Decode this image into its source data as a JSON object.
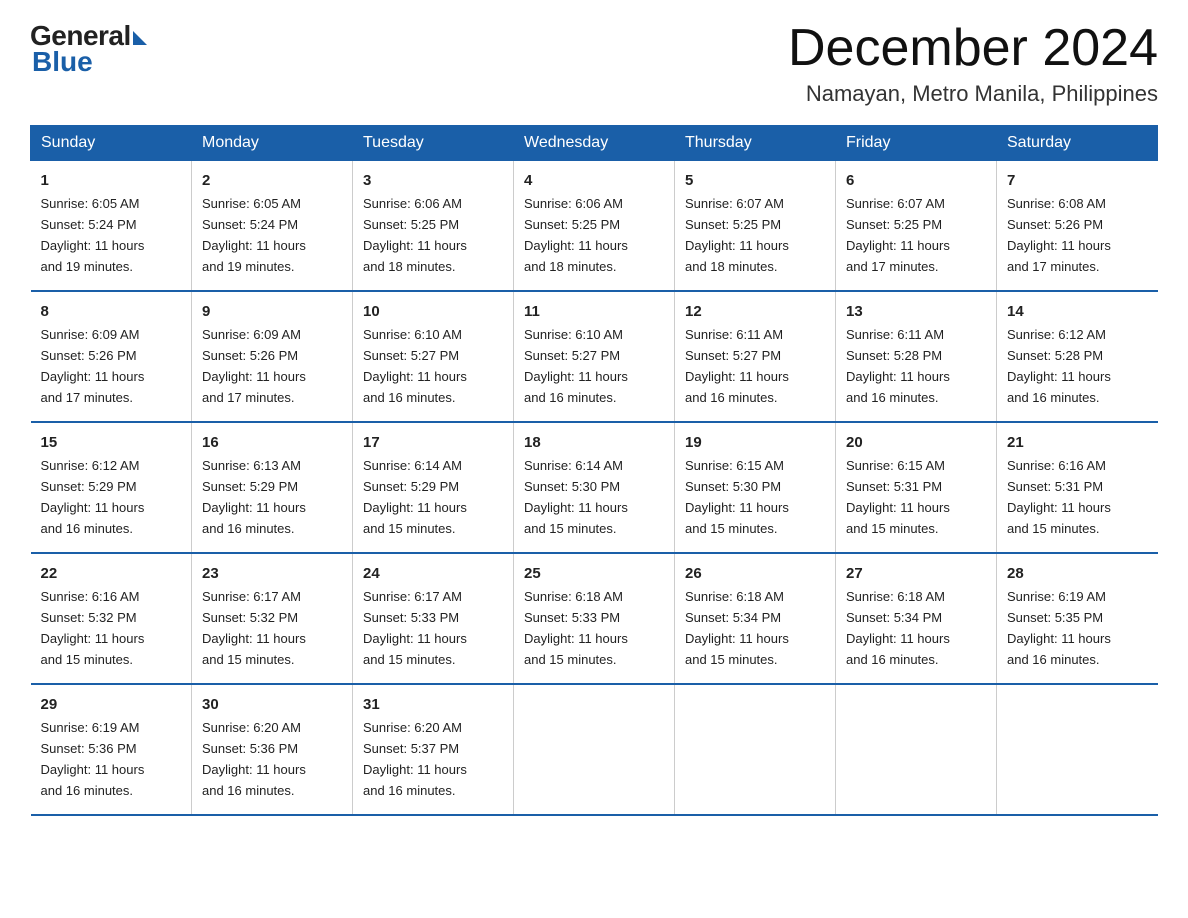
{
  "logo": {
    "general": "General",
    "blue": "Blue"
  },
  "title": "December 2024",
  "location": "Namayan, Metro Manila, Philippines",
  "days_of_week": [
    "Sunday",
    "Monday",
    "Tuesday",
    "Wednesday",
    "Thursday",
    "Friday",
    "Saturday"
  ],
  "weeks": [
    [
      {
        "day": "1",
        "sunrise": "6:05 AM",
        "sunset": "5:24 PM",
        "daylight": "11 hours and 19 minutes."
      },
      {
        "day": "2",
        "sunrise": "6:05 AM",
        "sunset": "5:24 PM",
        "daylight": "11 hours and 19 minutes."
      },
      {
        "day": "3",
        "sunrise": "6:06 AM",
        "sunset": "5:25 PM",
        "daylight": "11 hours and 18 minutes."
      },
      {
        "day": "4",
        "sunrise": "6:06 AM",
        "sunset": "5:25 PM",
        "daylight": "11 hours and 18 minutes."
      },
      {
        "day": "5",
        "sunrise": "6:07 AM",
        "sunset": "5:25 PM",
        "daylight": "11 hours and 18 minutes."
      },
      {
        "day": "6",
        "sunrise": "6:07 AM",
        "sunset": "5:25 PM",
        "daylight": "11 hours and 17 minutes."
      },
      {
        "day": "7",
        "sunrise": "6:08 AM",
        "sunset": "5:26 PM",
        "daylight": "11 hours and 17 minutes."
      }
    ],
    [
      {
        "day": "8",
        "sunrise": "6:09 AM",
        "sunset": "5:26 PM",
        "daylight": "11 hours and 17 minutes."
      },
      {
        "day": "9",
        "sunrise": "6:09 AM",
        "sunset": "5:26 PM",
        "daylight": "11 hours and 17 minutes."
      },
      {
        "day": "10",
        "sunrise": "6:10 AM",
        "sunset": "5:27 PM",
        "daylight": "11 hours and 16 minutes."
      },
      {
        "day": "11",
        "sunrise": "6:10 AM",
        "sunset": "5:27 PM",
        "daylight": "11 hours and 16 minutes."
      },
      {
        "day": "12",
        "sunrise": "6:11 AM",
        "sunset": "5:27 PM",
        "daylight": "11 hours and 16 minutes."
      },
      {
        "day": "13",
        "sunrise": "6:11 AM",
        "sunset": "5:28 PM",
        "daylight": "11 hours and 16 minutes."
      },
      {
        "day": "14",
        "sunrise": "6:12 AM",
        "sunset": "5:28 PM",
        "daylight": "11 hours and 16 minutes."
      }
    ],
    [
      {
        "day": "15",
        "sunrise": "6:12 AM",
        "sunset": "5:29 PM",
        "daylight": "11 hours and 16 minutes."
      },
      {
        "day": "16",
        "sunrise": "6:13 AM",
        "sunset": "5:29 PM",
        "daylight": "11 hours and 16 minutes."
      },
      {
        "day": "17",
        "sunrise": "6:14 AM",
        "sunset": "5:29 PM",
        "daylight": "11 hours and 15 minutes."
      },
      {
        "day": "18",
        "sunrise": "6:14 AM",
        "sunset": "5:30 PM",
        "daylight": "11 hours and 15 minutes."
      },
      {
        "day": "19",
        "sunrise": "6:15 AM",
        "sunset": "5:30 PM",
        "daylight": "11 hours and 15 minutes."
      },
      {
        "day": "20",
        "sunrise": "6:15 AM",
        "sunset": "5:31 PM",
        "daylight": "11 hours and 15 minutes."
      },
      {
        "day": "21",
        "sunrise": "6:16 AM",
        "sunset": "5:31 PM",
        "daylight": "11 hours and 15 minutes."
      }
    ],
    [
      {
        "day": "22",
        "sunrise": "6:16 AM",
        "sunset": "5:32 PM",
        "daylight": "11 hours and 15 minutes."
      },
      {
        "day": "23",
        "sunrise": "6:17 AM",
        "sunset": "5:32 PM",
        "daylight": "11 hours and 15 minutes."
      },
      {
        "day": "24",
        "sunrise": "6:17 AM",
        "sunset": "5:33 PM",
        "daylight": "11 hours and 15 minutes."
      },
      {
        "day": "25",
        "sunrise": "6:18 AM",
        "sunset": "5:33 PM",
        "daylight": "11 hours and 15 minutes."
      },
      {
        "day": "26",
        "sunrise": "6:18 AM",
        "sunset": "5:34 PM",
        "daylight": "11 hours and 15 minutes."
      },
      {
        "day": "27",
        "sunrise": "6:18 AM",
        "sunset": "5:34 PM",
        "daylight": "11 hours and 16 minutes."
      },
      {
        "day": "28",
        "sunrise": "6:19 AM",
        "sunset": "5:35 PM",
        "daylight": "11 hours and 16 minutes."
      }
    ],
    [
      {
        "day": "29",
        "sunrise": "6:19 AM",
        "sunset": "5:36 PM",
        "daylight": "11 hours and 16 minutes."
      },
      {
        "day": "30",
        "sunrise": "6:20 AM",
        "sunset": "5:36 PM",
        "daylight": "11 hours and 16 minutes."
      },
      {
        "day": "31",
        "sunrise": "6:20 AM",
        "sunset": "5:37 PM",
        "daylight": "11 hours and 16 minutes."
      },
      null,
      null,
      null,
      null
    ]
  ],
  "label_sunrise": "Sunrise:",
  "label_sunset": "Sunset:",
  "label_daylight": "Daylight:"
}
